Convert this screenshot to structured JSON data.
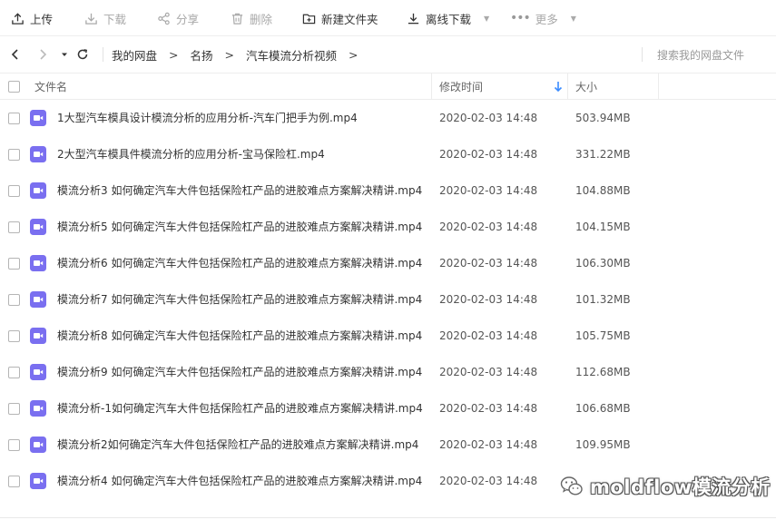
{
  "toolbar": {
    "upload": "上传",
    "download": "下载",
    "share": "分享",
    "delete": "删除",
    "new_folder": "新建文件夹",
    "offline_download": "离线下载",
    "more": "更多"
  },
  "nav": {
    "breadcrumbs": [
      "我的网盘",
      "名扬",
      "汽车模流分析视频"
    ],
    "search_placeholder": "搜索我的网盘文件"
  },
  "table": {
    "columns": {
      "name": "文件名",
      "modified": "修改时间",
      "size": "大小"
    },
    "sort": {
      "column": "修改时间",
      "direction": "descending"
    },
    "rows": [
      {
        "name": "1大型汽车模具设计模流分析的应用分析-汽车门把手为例.mp4",
        "modified": "2020-02-03 14:48",
        "size": "503.94MB"
      },
      {
        "name": "2大型汽车模具件模流分析的应用分析-宝马保险杠.mp4",
        "modified": "2020-02-03 14:48",
        "size": "331.22MB"
      },
      {
        "name": "模流分析3 如何确定汽车大件包括保险杠产品的进胶难点方案解决精讲.mp4",
        "modified": "2020-02-03 14:48",
        "size": "104.88MB"
      },
      {
        "name": "模流分析5 如何确定汽车大件包括保险杠产品的进胶难点方案解决精讲.mp4",
        "modified": "2020-02-03 14:48",
        "size": "104.15MB"
      },
      {
        "name": "模流分析6 如何确定汽车大件包括保险杠产品的进胶难点方案解决精讲.mp4",
        "modified": "2020-02-03 14:48",
        "size": "106.30MB"
      },
      {
        "name": "模流分析7 如何确定汽车大件包括保险杠产品的进胶难点方案解决精讲.mp4",
        "modified": "2020-02-03 14:48",
        "size": "101.32MB"
      },
      {
        "name": "模流分析8 如何确定汽车大件包括保险杠产品的进胶难点方案解决精讲.mp4",
        "modified": "2020-02-03 14:48",
        "size": "105.75MB"
      },
      {
        "name": "模流分析9 如何确定汽车大件包括保险杠产品的进胶难点方案解决精讲.mp4",
        "modified": "2020-02-03 14:48",
        "size": "112.68MB"
      },
      {
        "name": "模流分析-1如何确定汽车大件包括保险杠产品的进胶难点方案解决精讲.mp4",
        "modified": "2020-02-03 14:48",
        "size": "106.68MB"
      },
      {
        "name": "模流分析2如何确定汽车大件包括保险杠产品的进胶难点方案解决精讲.mp4",
        "modified": "2020-02-03 14:48",
        "size": "109.95MB"
      },
      {
        "name": "模流分析4 如何确定汽车大件包括保险杠产品的进胶难点方案解决精讲.mp4",
        "modified": "2020-02-03 14:48",
        "size": ""
      }
    ]
  },
  "watermark": {
    "text": "moldflow模流分析",
    "icon": "wechat-icon"
  },
  "colors": {
    "video_icon": "#7a6ff0",
    "sort_arrow": "#3b8cff",
    "text": "#333333",
    "disabled": "#a8a8a8"
  }
}
